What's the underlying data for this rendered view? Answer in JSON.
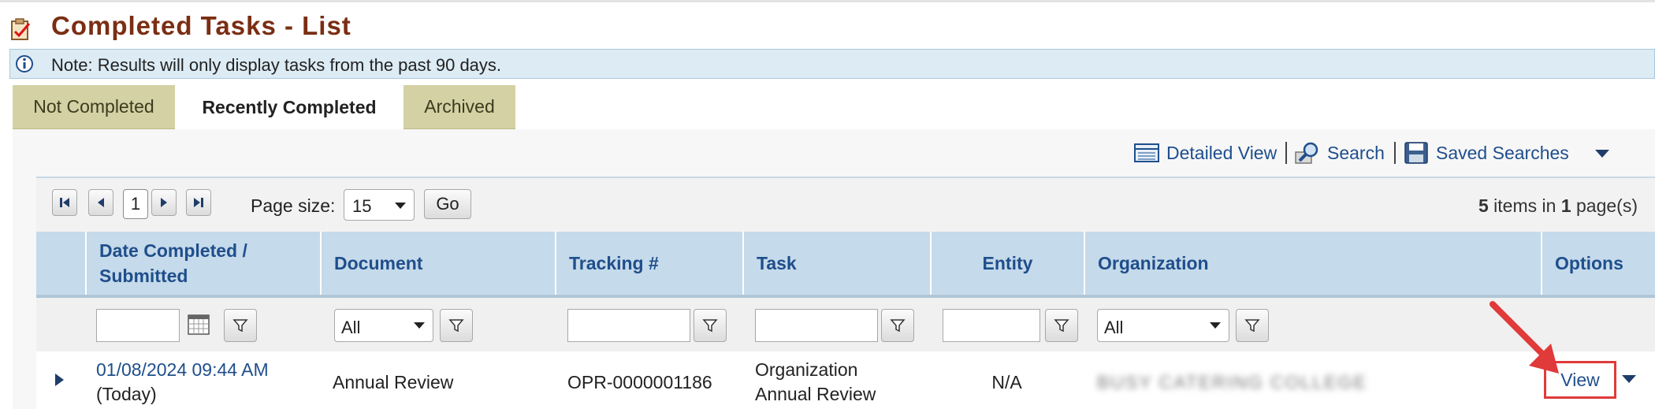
{
  "page": {
    "title": "Completed Tasks - List",
    "note": "Note: Results will only display tasks from the past 90 days."
  },
  "tabs": [
    {
      "label": "Not Completed",
      "active": false
    },
    {
      "label": "Recently Completed",
      "active": true
    },
    {
      "label": "Archived",
      "active": false
    }
  ],
  "toolbar": {
    "detailed_view": "Detailed View",
    "search": "Search",
    "saved_searches": "Saved Searches"
  },
  "pager": {
    "current_page": "1",
    "page_size_label": "Page size:",
    "page_size": "15",
    "go_label": "Go",
    "items_count": "5",
    "items_text_1": " items in ",
    "page_count": "1",
    "items_text_2": " page(s)"
  },
  "columns": {
    "date_line1": "Date Completed /",
    "date_line2": "Submitted",
    "document": "Document",
    "tracking": "Tracking #",
    "task": "Task",
    "entity": "Entity",
    "organization": "Organization",
    "options": "Options"
  },
  "filters": {
    "document": "All",
    "organization": "All"
  },
  "rows": [
    {
      "date_line1": "01/08/2024 09:44 AM",
      "date_line2": "(Today)",
      "document": "Annual Review",
      "tracking": "OPR-0000001186",
      "task_line1": "Organization",
      "task_line2": "Annual Review",
      "entity": "N/A",
      "organization": "BUSY CATERING COLLEGE",
      "view_label": "View"
    }
  ],
  "colors": {
    "title": "#7a2e12",
    "link": "#1f4e8c",
    "header_bg": "#c5daea",
    "tab_inactive_bg": "#d4d1a4",
    "highlight": "#e03a3a"
  },
  "icons": {
    "title": "clipboard-check-icon",
    "note": "info-icon",
    "detailed_view": "table-view-icon",
    "search": "magnifier-icon",
    "saved_searches": "floppy-disk-icon"
  }
}
